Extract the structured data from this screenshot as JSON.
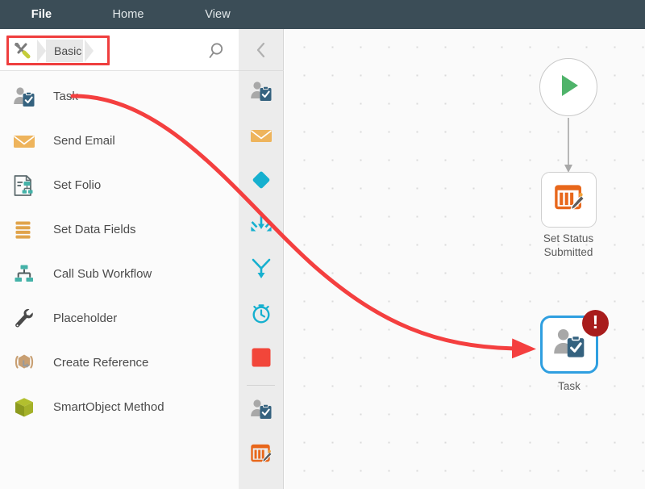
{
  "menubar": {
    "items": [
      {
        "label": "File",
        "name": "menu-item-file",
        "active": true
      },
      {
        "label": "Home",
        "name": "menu-item-home",
        "active": false
      },
      {
        "label": "View",
        "name": "menu-item-view",
        "active": false
      }
    ],
    "background_color": "#3b4d57"
  },
  "left_panel": {
    "breadcrumb": {
      "tools_icon": "tools-icon",
      "current": "Basic",
      "highlight_color": "#ef3e3e",
      "highlighted": true
    },
    "search": {
      "icon": "search-icon",
      "placeholder": "Search"
    },
    "items": [
      {
        "label": "Task",
        "icon": "task-icon"
      },
      {
        "label": "Send Email",
        "icon": "envelope-icon"
      },
      {
        "label": "Set Folio",
        "icon": "set-folio-icon"
      },
      {
        "label": "Set Data Fields",
        "icon": "set-data-fields-icon"
      },
      {
        "label": "Call Sub Workflow",
        "icon": "call-sub-workflow-icon"
      },
      {
        "label": "Placeholder",
        "icon": "wrench-icon"
      },
      {
        "label": "Create Reference",
        "icon": "create-reference-icon"
      },
      {
        "label": "SmartObject Method",
        "icon": "smartobject-cube-icon"
      }
    ]
  },
  "icon_strip": {
    "collapse_icon": "chevron-left-icon",
    "items": [
      {
        "icon": "task-icon",
        "color": "#35627f"
      },
      {
        "icon": "envelope-icon",
        "color": "#eeb45c"
      },
      {
        "icon": "diamond-decision-icon",
        "color": "#16b0cf"
      },
      {
        "icon": "merge-arrows-icon",
        "color": "#16b0cf"
      },
      {
        "icon": "split-arrow-icon",
        "color": "#16b0cf"
      },
      {
        "icon": "timer-clock-icon",
        "color": "#16b0cf"
      },
      {
        "icon": "stop-square-icon",
        "color": "#f2463a"
      },
      {
        "icon": "task-icon",
        "color": "#35627f"
      },
      {
        "icon": "set-status-icon",
        "color": "#e8671b"
      }
    ]
  },
  "canvas": {
    "background_color": "#fafafa",
    "dot_color": "#dadada",
    "nodes": [
      {
        "name": "start-node",
        "label": "",
        "icon": "play-triangle-icon",
        "color": "#4fb36a"
      },
      {
        "name": "set-status-node",
        "label": "Set Status\nSubmitted",
        "icon": "set-status-icon",
        "color": "#e8671b"
      },
      {
        "name": "task-node",
        "label": "Task",
        "icon": "task-icon",
        "color": "#35627f",
        "selected": true,
        "selection_color": "#2f9fe0",
        "badge": {
          "text": "!",
          "color": "#a81c1c",
          "name": "error-badge"
        }
      }
    ],
    "set_status_label_line1": "Set Status",
    "set_status_label_line2": "Submitted",
    "task_label": "Task"
  },
  "annotation": {
    "arrow_color": "#f43f3f",
    "from": "Task palette item",
    "to": "Task node on canvas"
  }
}
